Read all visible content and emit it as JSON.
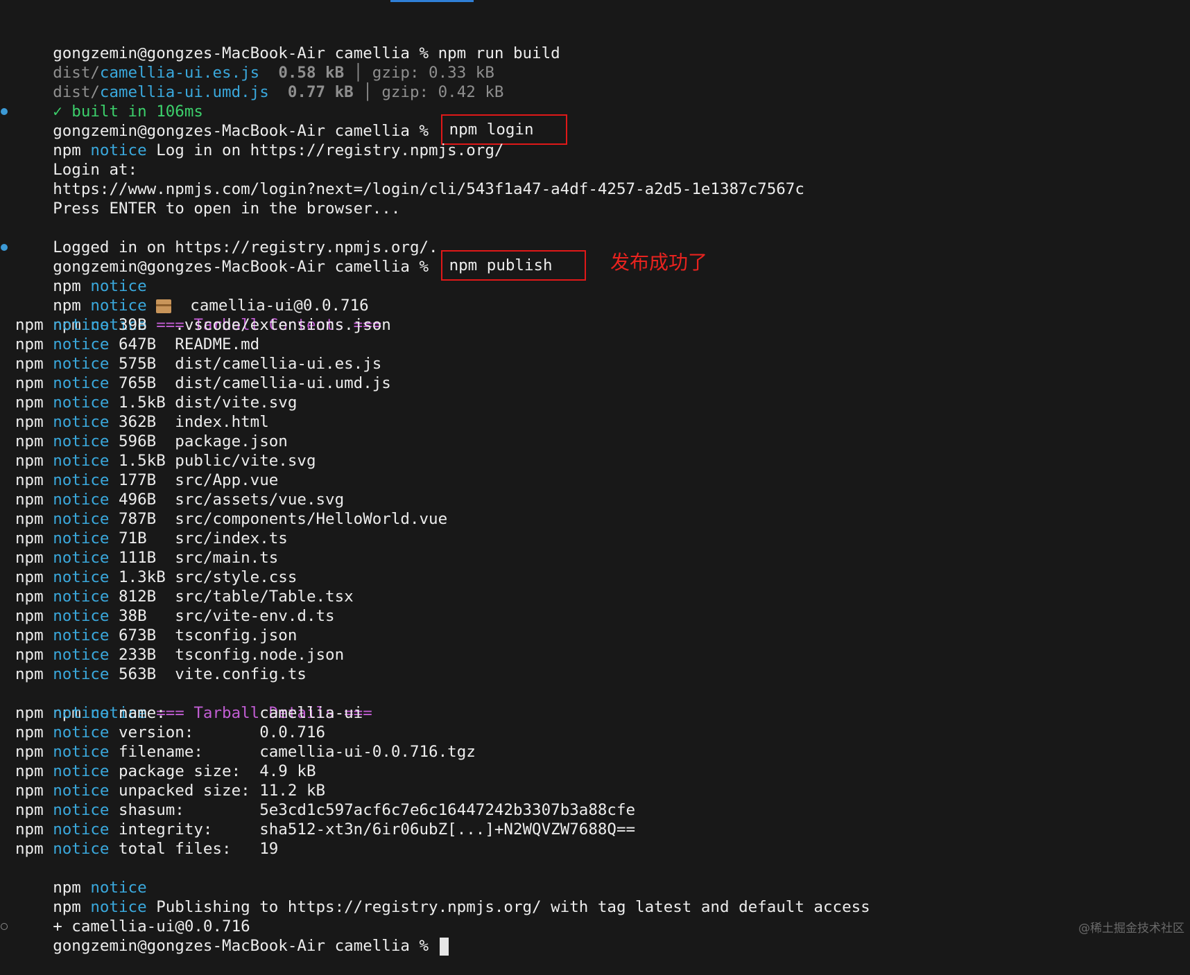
{
  "build": {
    "prompt": "gongzemin@gongzes-MacBook-Air camellia % ",
    "command": "npm run build",
    "outputs": [
      {
        "prefix": "dist/",
        "file": "camellia-ui.es.js",
        "pad": "  ",
        "size": "0.58 kB",
        "sep": " │ ",
        "gzip": "gzip: 0.33 kB"
      },
      {
        "prefix": "dist/",
        "file": "camellia-ui.umd.js",
        "pad": "  ",
        "size": "0.77 kB",
        "sep": " │ ",
        "gzip": "gzip: 0.42 kB"
      }
    ],
    "built": "✓ built in 106ms"
  },
  "login": {
    "prompt": "gongzemin@gongzes-MacBook-Air camellia % ",
    "command": "npm login",
    "notice": "Log in on https://registry.npmjs.org/",
    "login_at": "Login at:",
    "url": "https://www.npmjs.com/login?next=/login/cli/543f1a47-a4df-4257-a2d5-1e1387c7567c",
    "press_enter": "Press ENTER to open in the browser...",
    "logged_in": "Logged in on https://registry.npmjs.org/."
  },
  "publish": {
    "prompt": "gongzemin@gongzes-MacBook-Air camellia % ",
    "command": "npm publish",
    "annotation": "发布成功了",
    "npm": "npm",
    "notice": "notice",
    "package_id": "camellia-ui@0.0.716",
    "contents_header": "=== Tarball Contents ===",
    "files": [
      {
        "size": "39B  ",
        "path": ".vscode/extensions.json"
      },
      {
        "size": "647B ",
        "path": "README.md"
      },
      {
        "size": "575B ",
        "path": "dist/camellia-ui.es.js"
      },
      {
        "size": "765B ",
        "path": "dist/camellia-ui.umd.js"
      },
      {
        "size": "1.5kB",
        "path": "dist/vite.svg"
      },
      {
        "size": "362B ",
        "path": "index.html"
      },
      {
        "size": "596B ",
        "path": "package.json"
      },
      {
        "size": "1.5kB",
        "path": "public/vite.svg"
      },
      {
        "size": "177B ",
        "path": "src/App.vue"
      },
      {
        "size": "496B ",
        "path": "src/assets/vue.svg"
      },
      {
        "size": "787B ",
        "path": "src/components/HelloWorld.vue"
      },
      {
        "size": "71B  ",
        "path": "src/index.ts"
      },
      {
        "size": "111B ",
        "path": "src/main.ts"
      },
      {
        "size": "1.3kB",
        "path": "src/style.css"
      },
      {
        "size": "812B ",
        "path": "src/table/Table.tsx"
      },
      {
        "size": "38B  ",
        "path": "src/vite-env.d.ts"
      },
      {
        "size": "673B ",
        "path": "tsconfig.json"
      },
      {
        "size": "233B ",
        "path": "tsconfig.node.json"
      },
      {
        "size": "563B ",
        "path": "vite.config.ts"
      }
    ],
    "details_header": "=== Tarball Details ===",
    "details": [
      {
        "key": "name:          ",
        "value": "camellia-ui"
      },
      {
        "key": "version:       ",
        "value": "0.0.716"
      },
      {
        "key": "filename:      ",
        "value": "camellia-ui-0.0.716.tgz"
      },
      {
        "key": "package size:  ",
        "value": "4.9 kB"
      },
      {
        "key": "unpacked size: ",
        "value": "11.2 kB"
      },
      {
        "key": "shasum:        ",
        "value": "5e3cd1c597acf6c7e6c16447242b3307b3a88cfe"
      },
      {
        "key": "integrity:     ",
        "value": "sha512-xt3n/6ir06ubZ[...]+N2WQVZW7688Q=="
      },
      {
        "key": "total files:   ",
        "value": "19"
      }
    ],
    "publishing": "Publishing to https://registry.npmjs.org/ with tag latest and default access",
    "result": "+ camellia-ui@0.0.716"
  },
  "final_prompt": "gongzemin@gongzes-MacBook-Air camellia % ",
  "watermark": "@稀土掘金技术社区",
  "colors": {
    "background": "#181818",
    "notice": "#3aa8dc",
    "header": "#c25ed4",
    "success": "#3ccf6b",
    "highlight_box": "#e01818",
    "annotation": "#e8231f"
  }
}
